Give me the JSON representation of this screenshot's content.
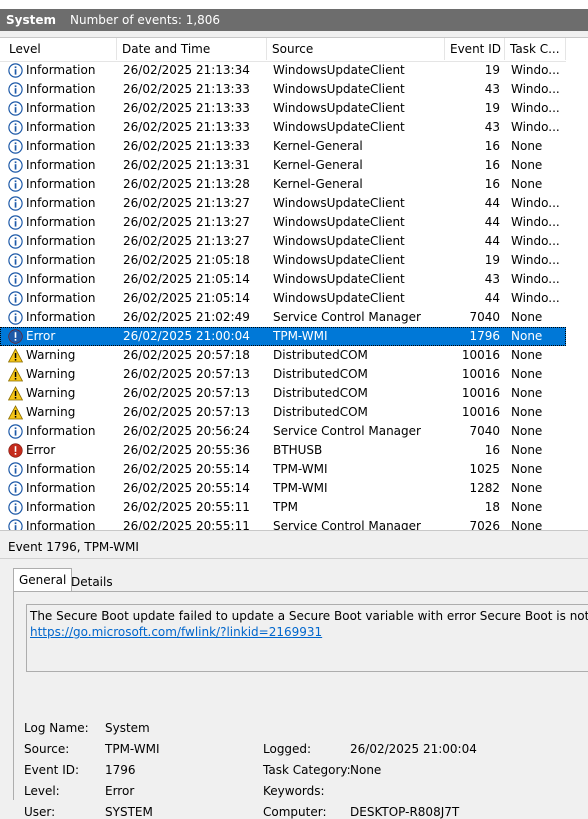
{
  "header": {
    "log_name": "System",
    "count_label": "Number of events: 1,806"
  },
  "columns": {
    "level": "Level",
    "date": "Date and Time",
    "source": "Source",
    "event_id": "Event ID",
    "task": "Task C..."
  },
  "rows": [
    {
      "level": "Information",
      "date": "26/02/2025 21:13:34",
      "source": "WindowsUpdateClient",
      "id": "19",
      "task": "Windo..."
    },
    {
      "level": "Information",
      "date": "26/02/2025 21:13:33",
      "source": "WindowsUpdateClient",
      "id": "43",
      "task": "Windo..."
    },
    {
      "level": "Information",
      "date": "26/02/2025 21:13:33",
      "source": "WindowsUpdateClient",
      "id": "19",
      "task": "Windo..."
    },
    {
      "level": "Information",
      "date": "26/02/2025 21:13:33",
      "source": "WindowsUpdateClient",
      "id": "43",
      "task": "Windo..."
    },
    {
      "level": "Information",
      "date": "26/02/2025 21:13:33",
      "source": "Kernel-General",
      "id": "16",
      "task": "None"
    },
    {
      "level": "Information",
      "date": "26/02/2025 21:13:31",
      "source": "Kernel-General",
      "id": "16",
      "task": "None"
    },
    {
      "level": "Information",
      "date": "26/02/2025 21:13:28",
      "source": "Kernel-General",
      "id": "16",
      "task": "None"
    },
    {
      "level": "Information",
      "date": "26/02/2025 21:13:27",
      "source": "WindowsUpdateClient",
      "id": "44",
      "task": "Windo..."
    },
    {
      "level": "Information",
      "date": "26/02/2025 21:13:27",
      "source": "WindowsUpdateClient",
      "id": "44",
      "task": "Windo..."
    },
    {
      "level": "Information",
      "date": "26/02/2025 21:13:27",
      "source": "WindowsUpdateClient",
      "id": "44",
      "task": "Windo..."
    },
    {
      "level": "Information",
      "date": "26/02/2025 21:05:18",
      "source": "WindowsUpdateClient",
      "id": "19",
      "task": "Windo..."
    },
    {
      "level": "Information",
      "date": "26/02/2025 21:05:14",
      "source": "WindowsUpdateClient",
      "id": "43",
      "task": "Windo..."
    },
    {
      "level": "Information",
      "date": "26/02/2025 21:05:14",
      "source": "WindowsUpdateClient",
      "id": "44",
      "task": "Windo..."
    },
    {
      "level": "Information",
      "date": "26/02/2025 21:02:49",
      "source": "Service Control Manager",
      "id": "7040",
      "task": "None"
    },
    {
      "level": "Error",
      "date": "26/02/2025 21:00:04",
      "source": "TPM-WMI",
      "id": "1796",
      "task": "None",
      "selected": true
    },
    {
      "level": "Warning",
      "date": "26/02/2025 20:57:18",
      "source": "DistributedCOM",
      "id": "10016",
      "task": "None"
    },
    {
      "level": "Warning",
      "date": "26/02/2025 20:57:13",
      "source": "DistributedCOM",
      "id": "10016",
      "task": "None"
    },
    {
      "level": "Warning",
      "date": "26/02/2025 20:57:13",
      "source": "DistributedCOM",
      "id": "10016",
      "task": "None"
    },
    {
      "level": "Warning",
      "date": "26/02/2025 20:57:13",
      "source": "DistributedCOM",
      "id": "10016",
      "task": "None"
    },
    {
      "level": "Information",
      "date": "26/02/2025 20:56:24",
      "source": "Service Control Manager",
      "id": "7040",
      "task": "None"
    },
    {
      "level": "Error",
      "date": "26/02/2025 20:55:36",
      "source": "BTHUSB",
      "id": "16",
      "task": "None"
    },
    {
      "level": "Information",
      "date": "26/02/2025 20:55:14",
      "source": "TPM-WMI",
      "id": "1025",
      "task": "None"
    },
    {
      "level": "Information",
      "date": "26/02/2025 20:55:14",
      "source": "TPM-WMI",
      "id": "1282",
      "task": "None"
    },
    {
      "level": "Information",
      "date": "26/02/2025 20:55:11",
      "source": "TPM",
      "id": "18",
      "task": "None"
    },
    {
      "level": "Information",
      "date": "26/02/2025 20:55:11",
      "source": "Service Control Manager",
      "id": "7026",
      "task": "None"
    }
  ],
  "detail": {
    "title": "Event 1796, TPM-WMI",
    "tab_general": "General",
    "tab_details": "Details",
    "description": "The Secure Boot update failed to update a Secure Boot variable with error Secure Boot is not enabled on this",
    "link": "https://go.microsoft.com/fwlink/?linkid=2169931",
    "labels": {
      "log_name": "Log Name:",
      "source": "Source:",
      "event_id": "Event ID:",
      "level": "Level:",
      "user": "User:",
      "logged": "Logged:",
      "task_category": "Task Category:",
      "keywords": "Keywords:",
      "computer": "Computer:"
    },
    "values": {
      "log_name": "System",
      "source": "TPM-WMI",
      "event_id": "1796",
      "level": "Error",
      "user": "SYSTEM",
      "logged": "26/02/2025 21:00:04",
      "task_category": "None",
      "keywords": "",
      "computer": "DESKTOP-R808J7T"
    }
  },
  "colors": {
    "header_bg": "#6d6d6d",
    "selected_bg": "#0078d7",
    "info_blue": "#1e5aa8",
    "error_red": "#c42b1c",
    "warning_yellow": "#f5c518"
  },
  "icons": {
    "Information": "info-icon",
    "Error": "error-icon",
    "Warning": "warning-icon"
  }
}
